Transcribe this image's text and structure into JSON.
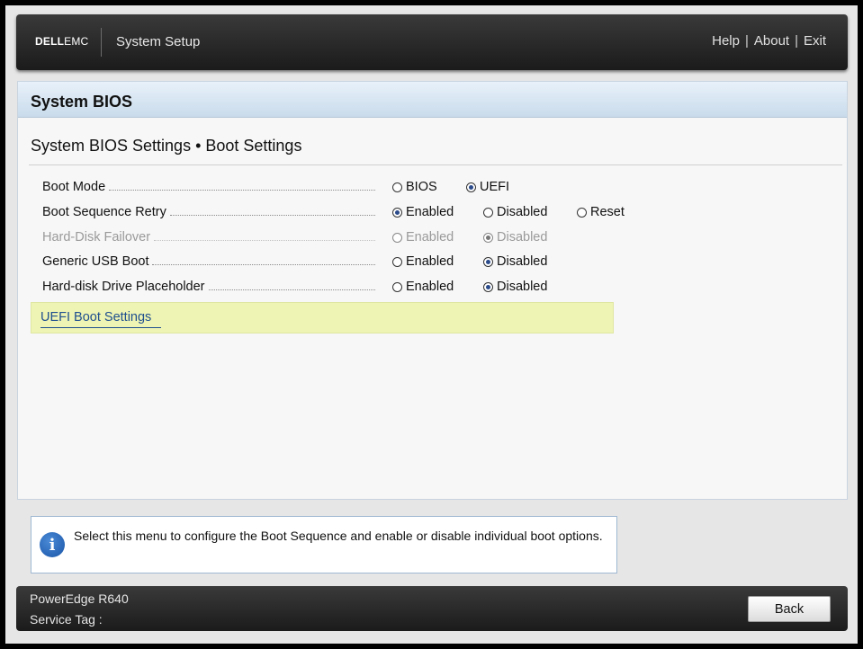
{
  "header": {
    "logo_bold": "DELL",
    "logo_light": "EMC",
    "app_title": "System Setup",
    "links": {
      "help": "Help",
      "about": "About",
      "exit": "Exit",
      "separator": "|"
    }
  },
  "panel": {
    "title": "System BIOS",
    "section_title": "System BIOS Settings • Boot Settings"
  },
  "settings": [
    {
      "label": "Boot Mode",
      "enabled": true,
      "options": [
        "BIOS",
        "UEFI"
      ],
      "selected": "UEFI"
    },
    {
      "label": "Boot Sequence Retry",
      "enabled": true,
      "options": [
        "Enabled",
        "Disabled",
        "Reset"
      ],
      "selected": "Enabled"
    },
    {
      "label": "Hard-Disk Failover",
      "enabled": false,
      "options": [
        "Enabled",
        "Disabled"
      ],
      "selected": "Disabled"
    },
    {
      "label": "Generic USB Boot",
      "enabled": true,
      "options": [
        "Enabled",
        "Disabled"
      ],
      "selected": "Disabled"
    },
    {
      "label": "Hard-disk Drive Placeholder",
      "enabled": true,
      "options": [
        "Enabled",
        "Disabled"
      ],
      "selected": "Disabled"
    }
  ],
  "submenu_link": "UEFI Boot Settings",
  "help_text": "Select this menu to configure the Boot Sequence and enable or disable individual boot options.",
  "footer": {
    "model": "PowerEdge R640",
    "service_tag_label": "Service Tag :",
    "back_label": "Back"
  },
  "colors": {
    "header_bg": "#2a2a2a",
    "panel_header": "#c9dbeb",
    "link_highlight": "#eef4b3",
    "link_color": "#1f4f8f",
    "radio_selected": "#2a4a8a"
  },
  "icons": {
    "info": "info-icon",
    "radio_on": "radio-selected-icon",
    "radio_off": "radio-unselected-icon"
  }
}
